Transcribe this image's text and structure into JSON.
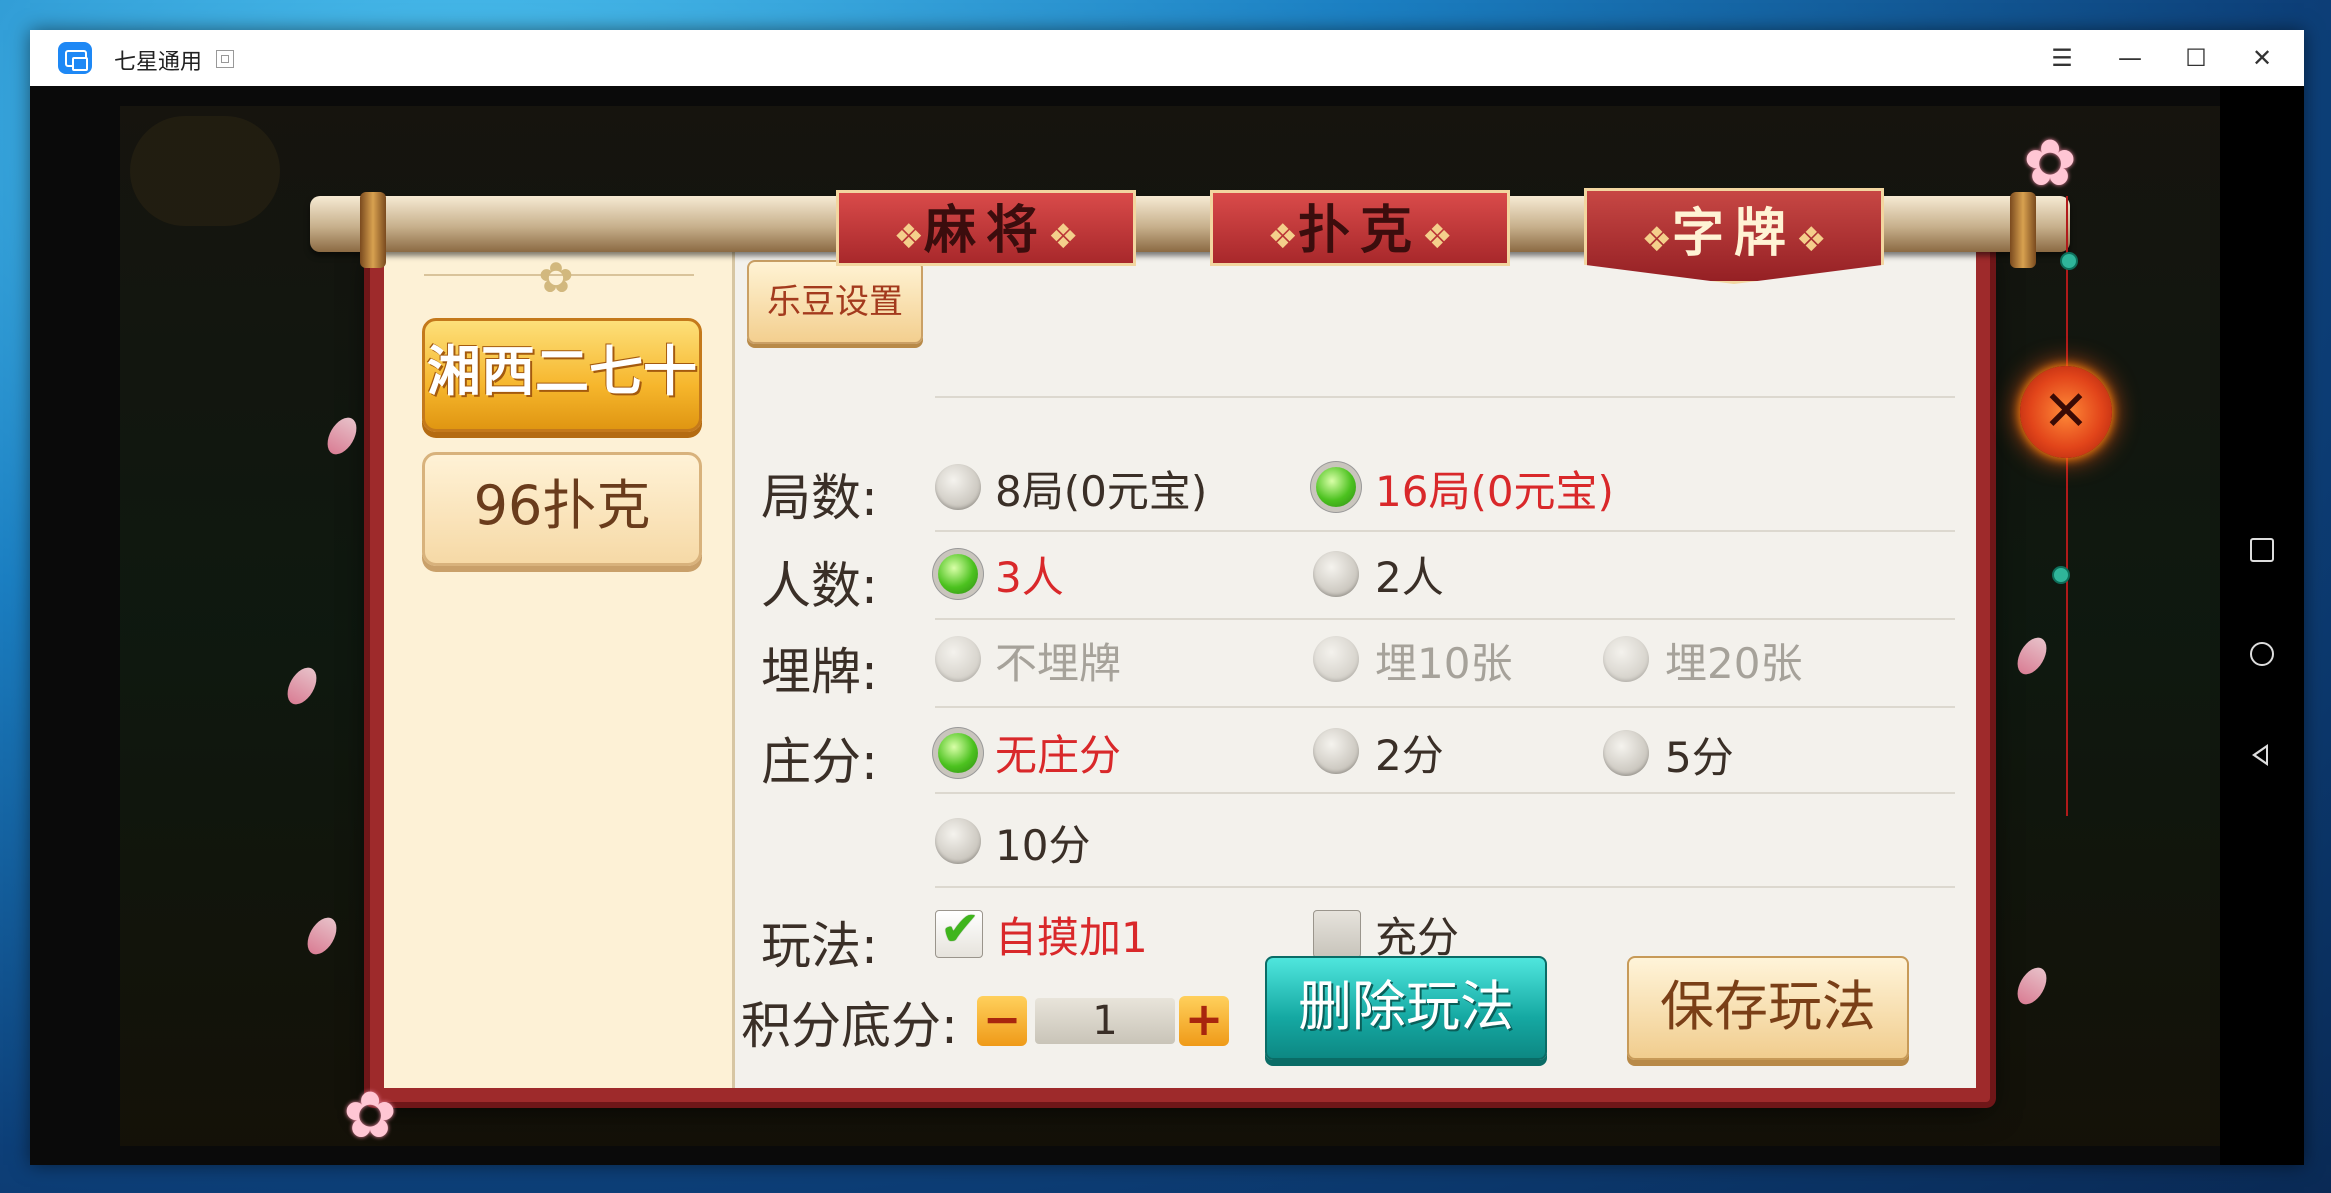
{
  "window": {
    "title": "七星通用",
    "menu_icon": "☰",
    "minimize_icon": "—",
    "maximize_icon": "☐",
    "close_icon": "✕"
  },
  "tabs": {
    "mahjong": "麻将",
    "poker": "扑克",
    "zipai": "字牌",
    "active": "字牌"
  },
  "sidebar": {
    "items": [
      {
        "label": "湘西二七十",
        "active": true
      },
      {
        "label": "96扑克",
        "active": false
      }
    ]
  },
  "main": {
    "ledou_button": "乐豆设置",
    "rows": [
      {
        "label": "局数:",
        "options": [
          {
            "text": "8局(0元宝)",
            "selected": false
          },
          {
            "text": "16局(0元宝)",
            "selected": true
          }
        ]
      },
      {
        "label": "人数:",
        "options": [
          {
            "text": "3人",
            "selected": true
          },
          {
            "text": "2人",
            "selected": false
          }
        ]
      },
      {
        "label": "埋牌:",
        "disabled": true,
        "options": [
          {
            "text": "不埋牌",
            "selected": false
          },
          {
            "text": "埋10张",
            "selected": false
          },
          {
            "text": "埋20张",
            "selected": false
          }
        ]
      },
      {
        "label": "庄分:",
        "options": [
          {
            "text": "无庄分",
            "selected": true
          },
          {
            "text": "2分",
            "selected": false
          },
          {
            "text": "5分",
            "selected": false
          },
          {
            "text": "10分",
            "selected": false
          }
        ]
      },
      {
        "label": "玩法:",
        "checkboxes": [
          {
            "text": "自摸加1",
            "checked": true
          },
          {
            "text": "充分",
            "checked": false
          }
        ]
      }
    ],
    "score": {
      "label": "积分底分:",
      "minus": "−",
      "value": "1",
      "plus": "+"
    },
    "delete_button": "删除玩法",
    "save_button": "保存玩法"
  },
  "close_dialog_icon": "✕",
  "colors": {
    "selected_text": "#d9282a",
    "disabled_text": "#a6a29a",
    "accent_red": "#a8282b",
    "delete_teal": "#15a8a2"
  }
}
